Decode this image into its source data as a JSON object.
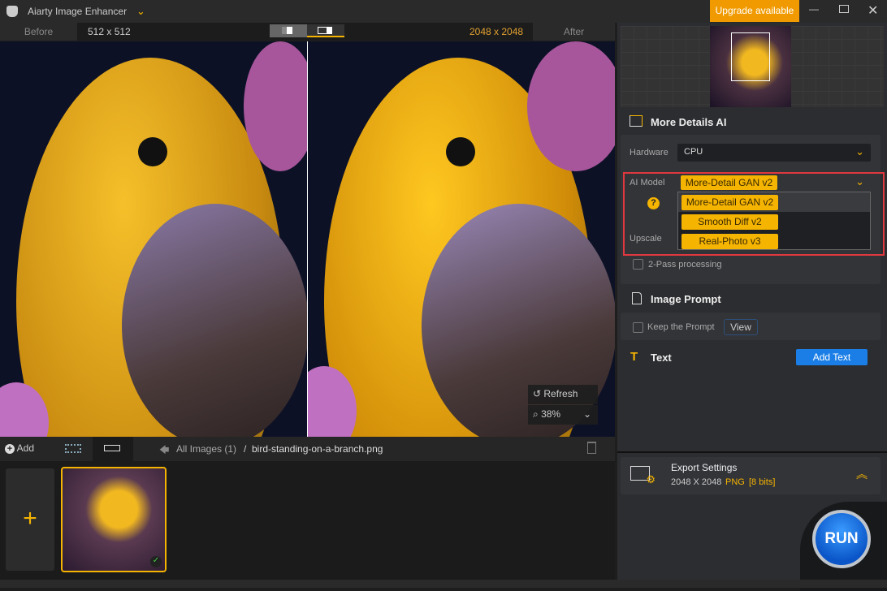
{
  "app": {
    "title": "Aiarty Image Enhancer",
    "upgrade": "Upgrade available"
  },
  "compare": {
    "before_label": "Before",
    "before_size": "512 x 512",
    "after_size": "2048 x 2048",
    "after_label": "After"
  },
  "overlay": {
    "refresh": "Refresh",
    "zoom": "38%"
  },
  "toolbar": {
    "add": "Add",
    "breadcrumb_root": "All Images (1)",
    "separator": "/",
    "filename": "bird-standing-on-a-branch.png"
  },
  "panel": {
    "more_details": {
      "title": "More Details AI",
      "hardware_label": "Hardware",
      "hardware_value": "CPU",
      "ai_model_label": "AI Model",
      "ai_model_value": "More-Detail GAN v2",
      "options": [
        "More-Detail GAN v2",
        "Smooth Diff v2",
        "Real-Photo v3"
      ],
      "upscale_label": "Upscale",
      "two_pass": "2-Pass processing"
    },
    "image_prompt": {
      "title": "Image Prompt",
      "keep": "Keep the Prompt",
      "view": "View"
    },
    "text": {
      "title": "Text",
      "add": "Add Text"
    },
    "export": {
      "title": "Export Settings",
      "size": "2048 X 2048",
      "format": "PNG",
      "bits": "[8 bits]"
    },
    "run": "RUN"
  },
  "colors": {
    "accent": "#f5b400",
    "button_blue": "#1a7ee6",
    "highlight_red": "#e0383e"
  }
}
